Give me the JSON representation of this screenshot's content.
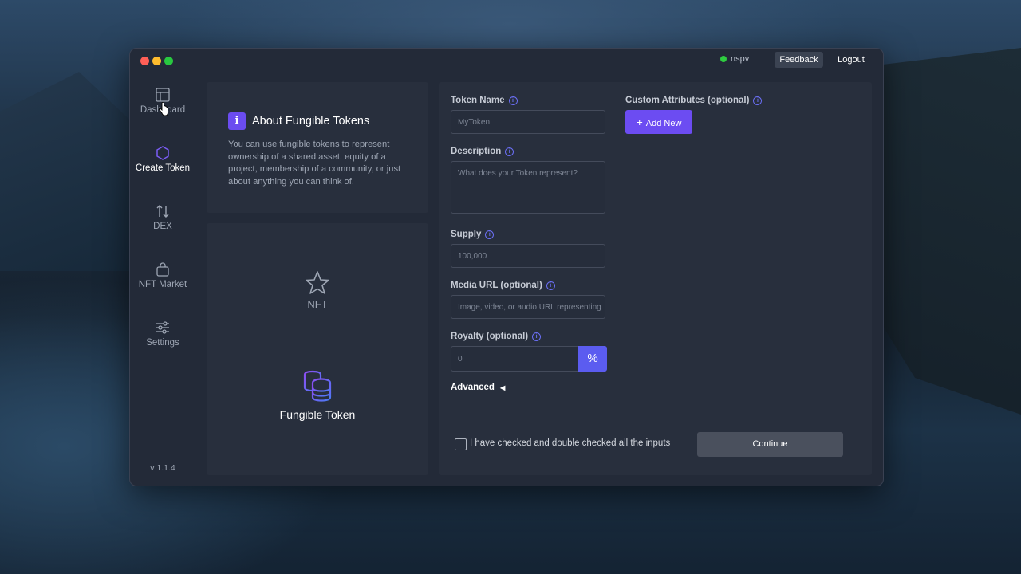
{
  "window": {
    "status_user": "nspv",
    "feedback_label": "Feedback",
    "logout_label": "Logout"
  },
  "sidebar": {
    "items": [
      {
        "label": "Dashboard",
        "icon": "dashboard-icon"
      },
      {
        "label": "Create Token",
        "icon": "hexagon-icon",
        "active": true
      },
      {
        "label": "DEX",
        "icon": "swap-arrows-icon"
      },
      {
        "label": "NFT Market",
        "icon": "shopping-bag-icon"
      },
      {
        "label": "Settings",
        "icon": "sliders-icon"
      }
    ],
    "version": "v 1.1.4"
  },
  "about": {
    "icon": "i",
    "title": "About Fungible Tokens",
    "text": "You can use fungible tokens to represent ownership of a shared asset, equity of a project, membership of a community, or just about anything you can think of."
  },
  "token_types": {
    "nft_label": "NFT",
    "fungible_label": "Fungible Token"
  },
  "form": {
    "token_name_label": "Token Name",
    "token_name_placeholder": "MyToken",
    "description_label": "Description",
    "description_placeholder": "What does your Token represent?",
    "supply_label": "Supply",
    "supply_placeholder": "100,000",
    "media_url_label": "Media URL (optional)",
    "media_url_placeholder": "Image, video, or audio URL representing",
    "royalty_label": "Royalty (optional)",
    "royalty_placeholder": "0",
    "royalty_unit": "%",
    "advanced_label": "Advanced",
    "custom_attributes_label": "Custom Attributes (optional)",
    "add_new_label": "Add New",
    "confirm_label": "I have checked and double checked all the inputs",
    "continue_label": "Continue"
  },
  "colors": {
    "accent": "#6c4cf2",
    "window_bg": "#232a38",
    "panel_bg": "#282f3d"
  }
}
